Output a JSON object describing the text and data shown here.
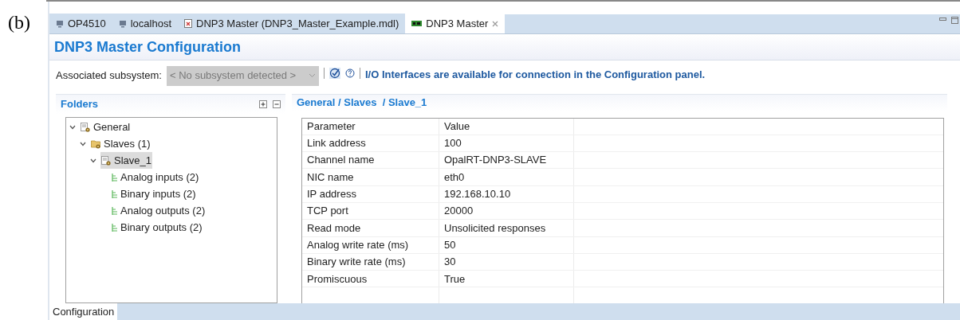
{
  "figure_label": "(b)",
  "tabs": [
    {
      "label": "OP4510",
      "selected": false,
      "kind": "computer"
    },
    {
      "label": "localhost",
      "selected": false,
      "kind": "computer"
    },
    {
      "label": "DNP3 Master (DNP3_Master_Example.mdl)",
      "selected": false,
      "kind": "model"
    },
    {
      "label": "DNP3 Master",
      "selected": true,
      "kind": "board"
    }
  ],
  "title": "DNP3 Master Configuration",
  "subsystem": {
    "label": "Associated subsystem:",
    "value": "< No subsystem detected >",
    "disabled": true
  },
  "info": "I/O Interfaces are available for connection in the Configuration panel.",
  "folders": {
    "title": "Folders",
    "tree": [
      {
        "label": "General",
        "kind": "config",
        "expanded": true,
        "selected": false,
        "children": [
          {
            "label": "Slaves (1)",
            "kind": "folder",
            "expanded": true,
            "selected": false,
            "children": [
              {
                "label": "Slave_1",
                "kind": "config",
                "expanded": true,
                "selected": true,
                "children": [
                  {
                    "label": "Analog inputs (2)",
                    "kind": "leaf",
                    "selected": false
                  },
                  {
                    "label": "Binary inputs (2)",
                    "kind": "leaf",
                    "selected": false
                  },
                  {
                    "label": "Analog outputs (2)",
                    "kind": "leaf",
                    "selected": false
                  },
                  {
                    "label": "Binary outputs (2)",
                    "kind": "leaf",
                    "selected": false
                  }
                ]
              }
            ]
          }
        ]
      }
    ]
  },
  "details": {
    "breadcrumb": "General / Slaves  / Slave_1",
    "columns": [
      "Parameter",
      "Value"
    ],
    "rows": [
      [
        "Link address",
        "100"
      ],
      [
        "Channel name",
        "OpalRT-DNP3-SLAVE"
      ],
      [
        "NIC name",
        "eth0"
      ],
      [
        "IP address",
        "192.168.10.10"
      ],
      [
        "TCP port",
        "20000"
      ],
      [
        "Read mode",
        "Unsolicited responses"
      ],
      [
        "Analog write rate (ms)",
        "50"
      ],
      [
        "Binary write rate (ms)",
        "30"
      ],
      [
        "Promiscuous",
        "True"
      ]
    ]
  },
  "bottom_tabs": [
    {
      "label": "Configuration",
      "selected": true
    }
  ]
}
